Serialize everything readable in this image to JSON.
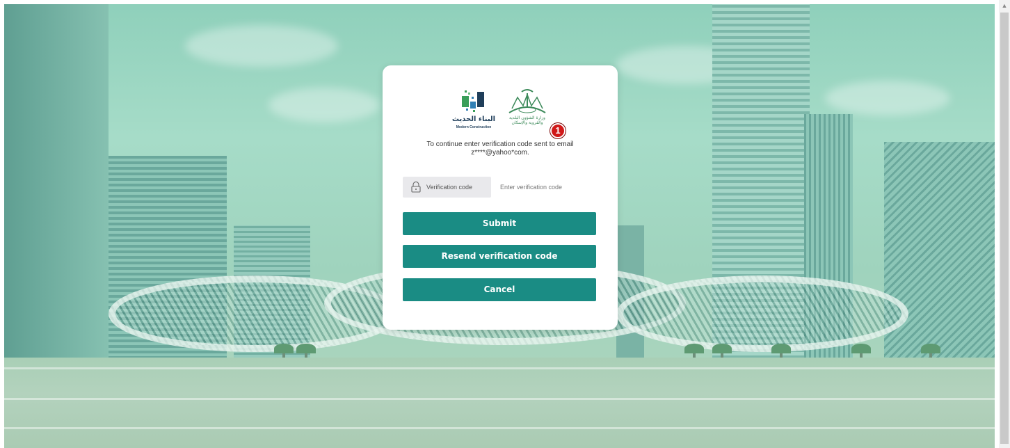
{
  "logos": {
    "modern_construction_ar": "البناء الحديث",
    "modern_construction_en": "Modern Construction",
    "ministry_ar_line1": "وزارة الشؤون البلدية",
    "ministry_ar_line2": "والقروية والإسكان"
  },
  "annotation": {
    "badge_number": "1"
  },
  "message": {
    "line1": "To continue enter verification code sent to email",
    "line2": "z****@yahoo*com."
  },
  "verification": {
    "label": "Verification code",
    "placeholder": "Enter verification code",
    "value": ""
  },
  "buttons": {
    "submit": "Submit",
    "resend": "Resend verification code",
    "cancel": "Cancel"
  },
  "colors": {
    "primary_button": "#1a8c84",
    "badge": "#d01818",
    "background_tint": "#9fd3bd"
  }
}
